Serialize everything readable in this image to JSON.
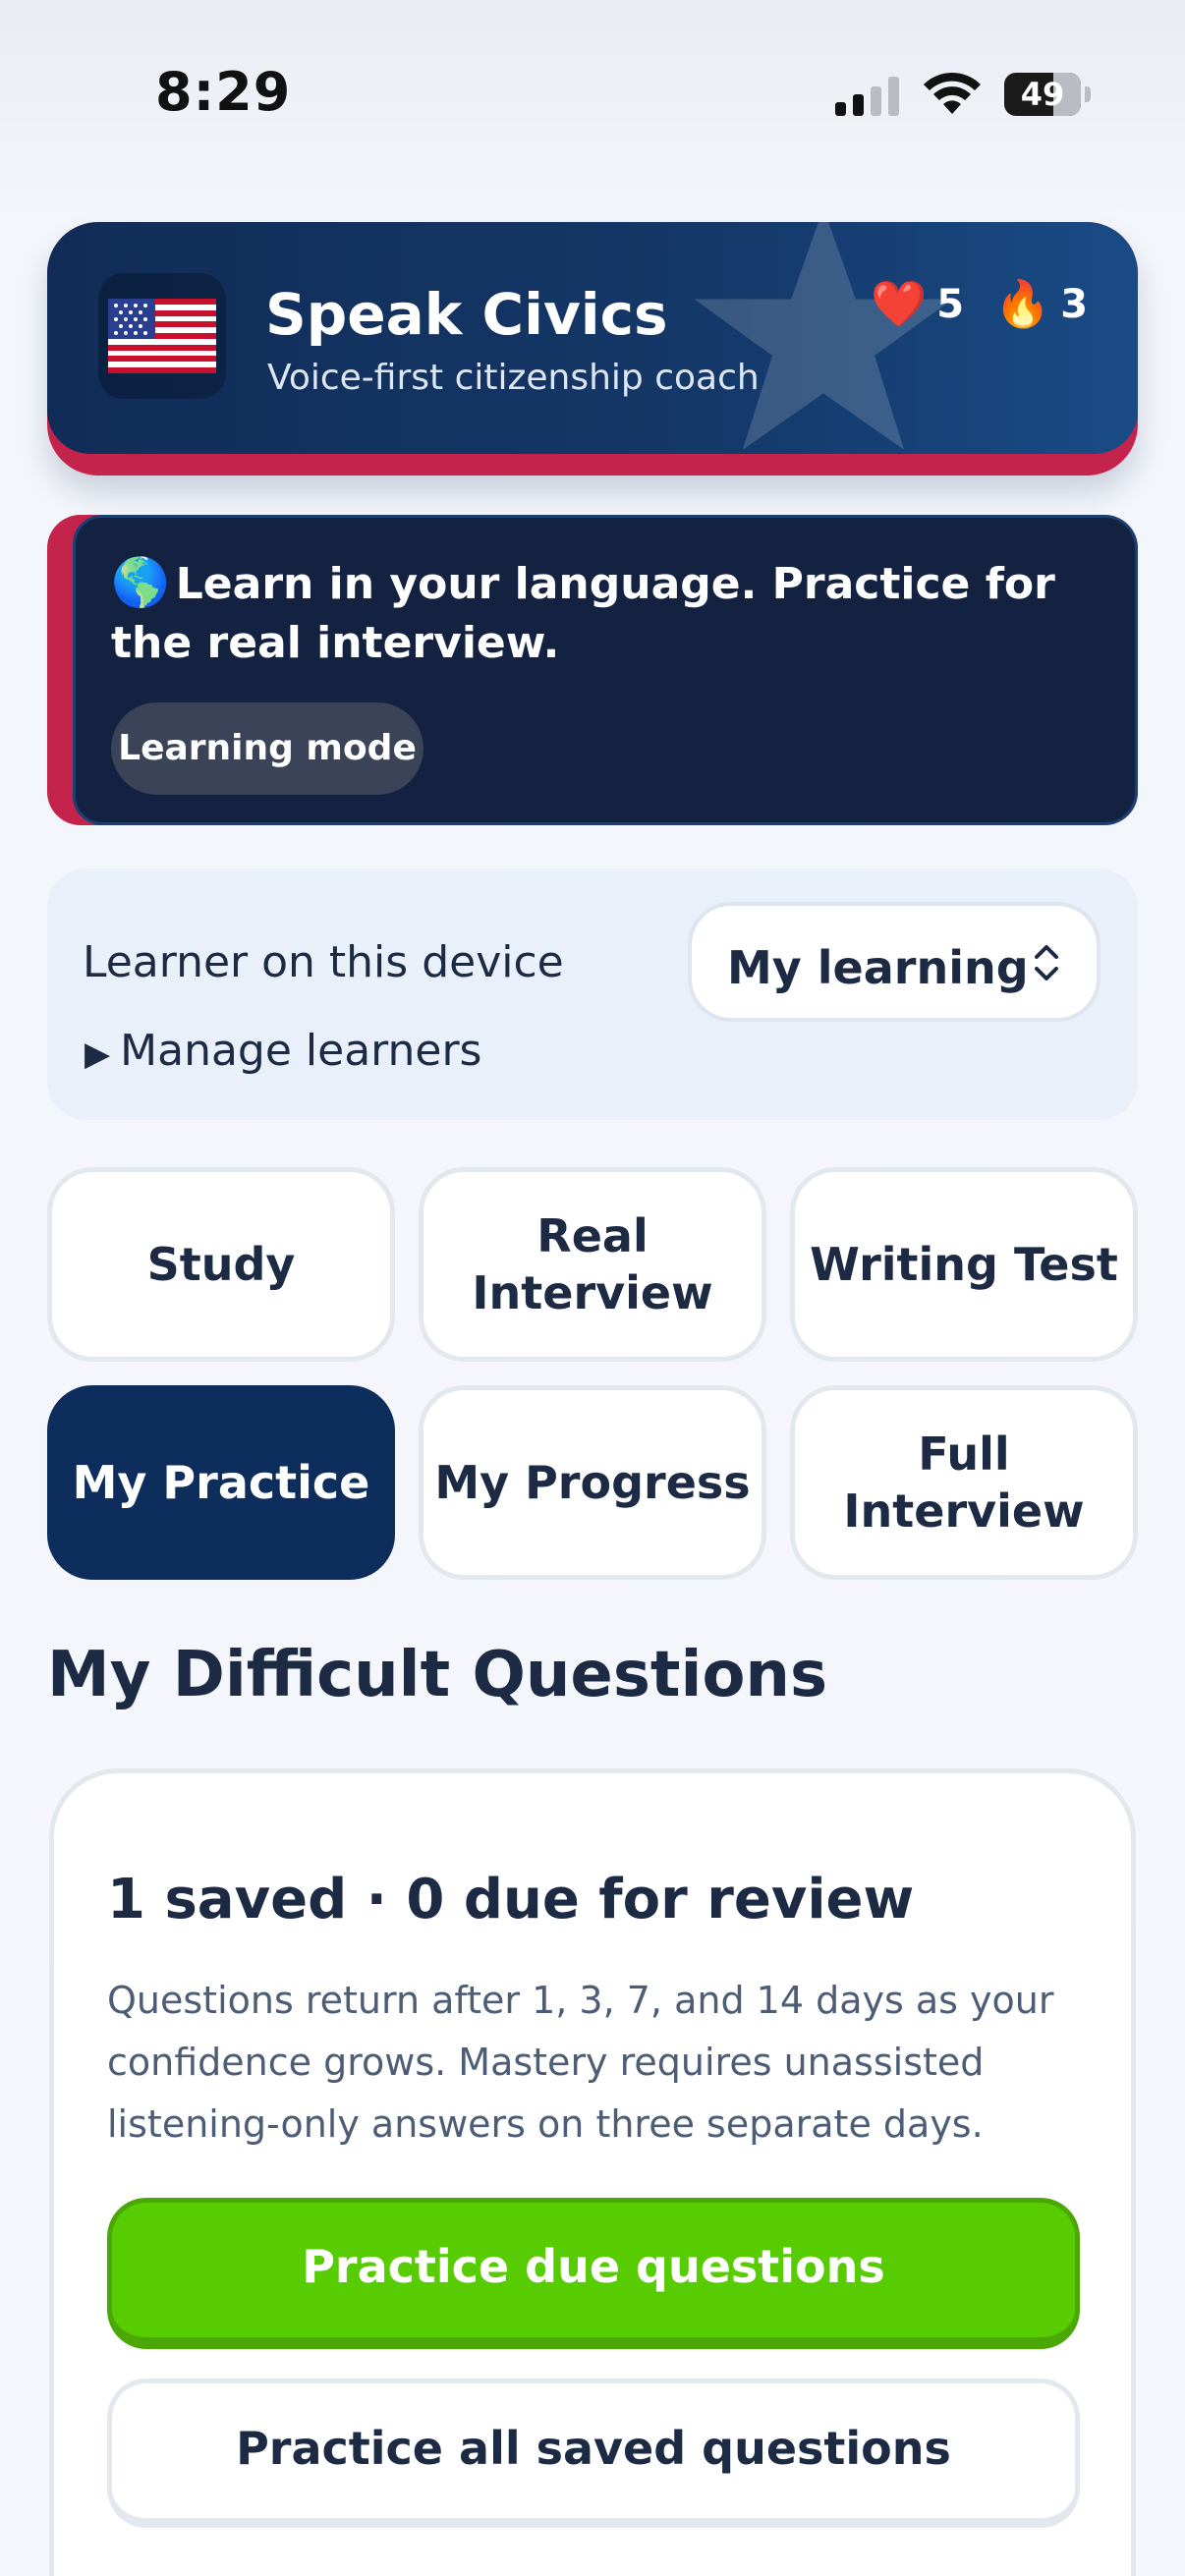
{
  "status_bar": {
    "time": "8:29",
    "battery": "49",
    "icons": [
      "cellular-signal-icon",
      "wifi-icon",
      "battery-icon"
    ]
  },
  "header": {
    "title": "Speak Civics",
    "subtitle": "Voice-first citizenship coach",
    "hearts": "5",
    "streak": "3",
    "heart_glyph": "❤️",
    "streak_glyph": "🔥",
    "colors": {
      "navy": "#112c57",
      "accent_red": "#c4234b"
    }
  },
  "banner": {
    "globe_glyph": "🌎",
    "text": "Learn in your language. Practice for the real interview.",
    "chip_label": "Learning mode"
  },
  "learner": {
    "label": "Learner on this device",
    "selected": "My learning",
    "manage_glyph": "▶",
    "manage_label": "Manage learners"
  },
  "nav": {
    "study": "Study",
    "real_interview": "Real Interview",
    "writing_test": "Writing Test",
    "my_practice": "My Practice",
    "my_progress": "My Progress",
    "full_interview": "Full Interview",
    "active": "My Practice"
  },
  "difficult": {
    "section_title": "My Difficult Questions",
    "heading": "1 saved · 0 due for review",
    "body": "Questions return after 1, 3, 7, and 14 days as your confidence grows. Mastery requires unassisted listening-only answers on three separate days.",
    "primary_button": "Practice due questions",
    "secondary_button": "Practice all saved questions",
    "colors": {
      "primary_green": "#58cc02"
    }
  }
}
